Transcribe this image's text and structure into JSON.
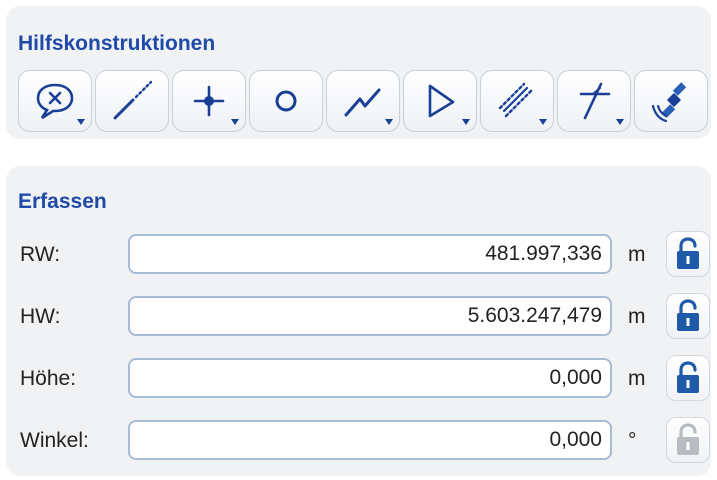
{
  "hilfskonstruktionen": {
    "title": "Hilfskonstruktionen",
    "tools": [
      {
        "icon": "speech-bubble-cross-icon",
        "has_dropdown": true
      },
      {
        "icon": "dotted-line-icon",
        "has_dropdown": false
      },
      {
        "icon": "point-crosshair-icon",
        "has_dropdown": true
      },
      {
        "icon": "circle-icon",
        "has_dropdown": false
      },
      {
        "icon": "polyline-icon",
        "has_dropdown": true
      },
      {
        "icon": "angle-icon",
        "has_dropdown": true
      },
      {
        "icon": "parallel-lines-icon",
        "has_dropdown": true
      },
      {
        "icon": "perpendicular-icon",
        "has_dropdown": true
      },
      {
        "icon": "satellite-gps-icon",
        "has_dropdown": false
      }
    ]
  },
  "erfassen": {
    "title": "Erfassen",
    "fields": [
      {
        "label": "RW:",
        "value": "481.997,336",
        "unit": "m",
        "lock_enabled": true
      },
      {
        "label": "HW:",
        "value": "5.603.247,479",
        "unit": "m",
        "lock_enabled": true
      },
      {
        "label": "Höhe:",
        "value": "0,000",
        "unit": "m",
        "lock_enabled": true
      },
      {
        "label": "Winkel:",
        "value": "0,000",
        "unit": "°",
        "lock_enabled": false
      }
    ]
  },
  "colors": {
    "title_blue": "#1f4aa8",
    "icon_blue": "#1a3f97",
    "lock_blue": "#1e5aa8",
    "lock_disabled": "#b8bcc2",
    "panel_bg": "#f1f2f4"
  }
}
